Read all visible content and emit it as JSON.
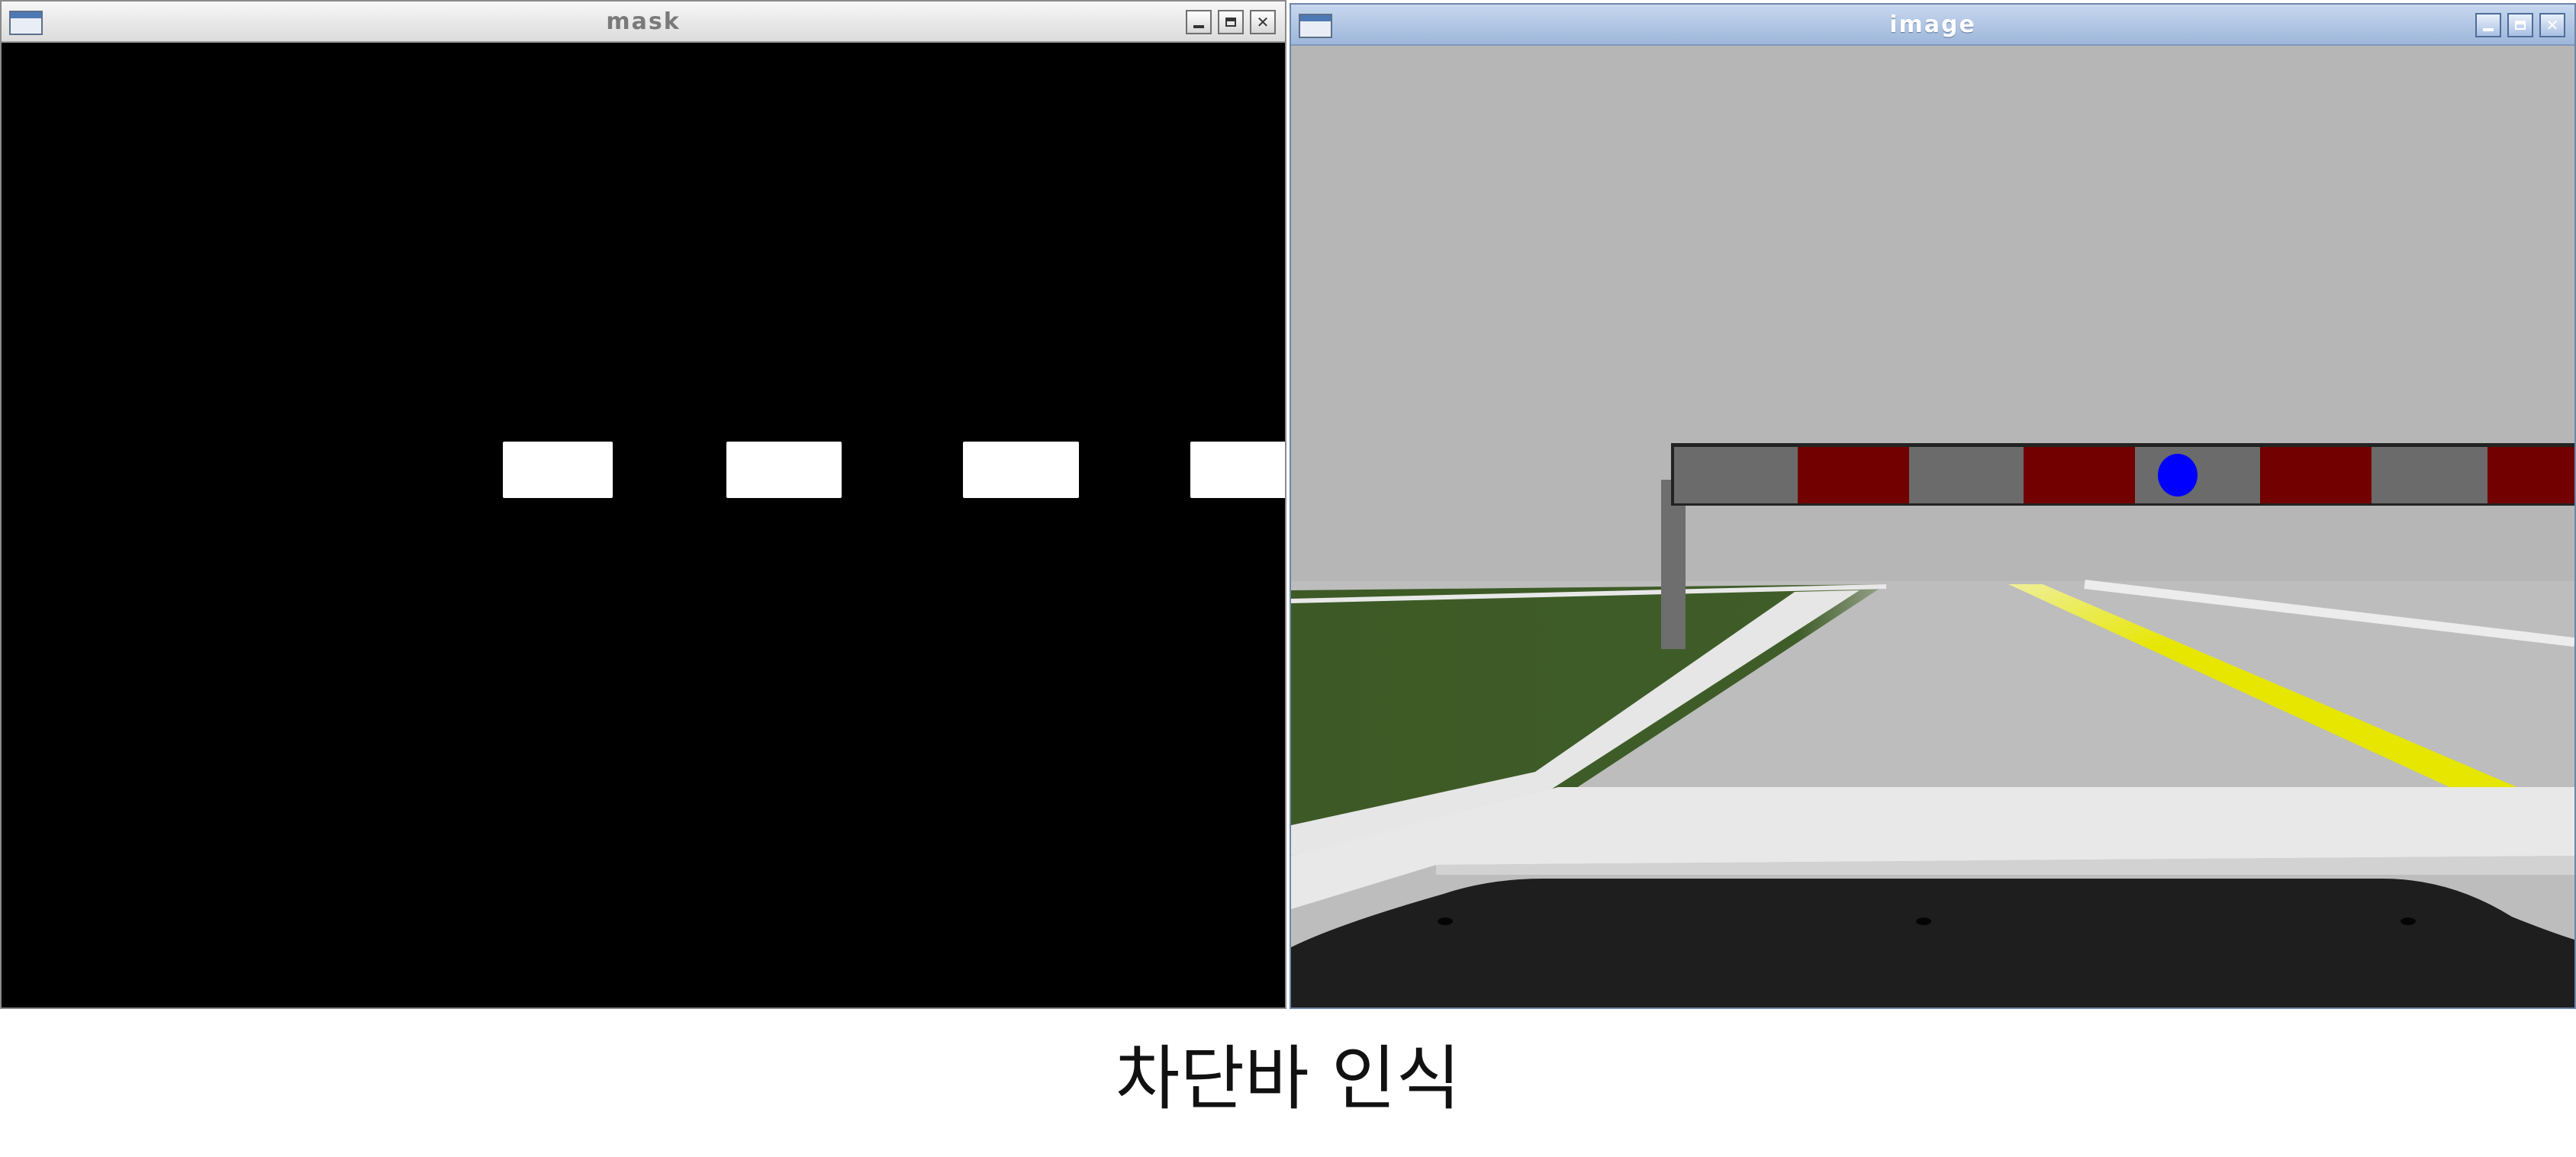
{
  "windows": {
    "mask": {
      "title": "mask",
      "icon": "window-icon",
      "controls": [
        "minimize-icon",
        "maximize-icon",
        "close-icon"
      ]
    },
    "image": {
      "title": "image",
      "icon": "window-icon",
      "controls": [
        "minimize-icon",
        "maximize-icon",
        "close-icon"
      ]
    }
  },
  "caption": "차단바 인식",
  "colors": {
    "mask_background": "#000000",
    "mask_blob": "#ffffff",
    "sky": "#b6b6b6",
    "grass": "#3d5a26",
    "road": "#bdbdbd",
    "center_line": "#e6e600",
    "barrier_gray": "#6b6b6b",
    "barrier_red": "#720000",
    "detection_dot": "#0000ff",
    "vehicle_hood": "#1e1e1e"
  }
}
